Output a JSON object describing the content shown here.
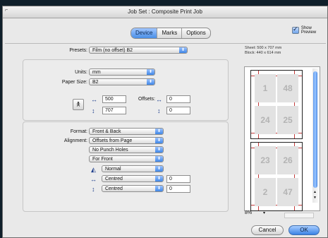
{
  "window": {
    "title": "Job Set : Composite Print Job"
  },
  "tabs": [
    {
      "label": "Device",
      "selected": true
    },
    {
      "label": "Marks",
      "selected": false
    },
    {
      "label": "Options",
      "selected": false
    }
  ],
  "show_preview": {
    "label": "Show Preview",
    "checked": true
  },
  "presets": {
    "label": "Presets:",
    "value": "Film (no offset) B2"
  },
  "units": {
    "label": "Units:",
    "value": "mm"
  },
  "paper_size": {
    "label": "Paper Size:",
    "value": "B2"
  },
  "width": {
    "value": "500"
  },
  "height": {
    "value": "707"
  },
  "offsets": {
    "label": "Offsets:",
    "x": "0",
    "y": "0"
  },
  "format": {
    "label": "Format:",
    "value": "Front & Back"
  },
  "alignment": {
    "label": "Alignment:",
    "value": "Offsets from Page"
  },
  "punch": {
    "value": "No Punch Holes"
  },
  "side": {
    "value": "For Front"
  },
  "scale": {
    "value": "Normal"
  },
  "horiz": {
    "value": "Centred",
    "offset": "0"
  },
  "vert": {
    "value": "Centred",
    "offset": "0"
  },
  "sheet_info": {
    "sheet": "Sheet: 500 x 707 mm",
    "block": "Block: 440 x 614 mm"
  },
  "preview": {
    "front_pages": [
      "1",
      "48",
      "24",
      "25"
    ],
    "back_pages": [
      "23",
      "26",
      "2",
      "47"
    ]
  },
  "zoom": {
    "value": "8%"
  },
  "buttons": {
    "cancel": "Cancel",
    "ok": "OK"
  },
  "colors": {
    "accent": "#4a8fe6",
    "crop_marks": "#c43a3a"
  }
}
